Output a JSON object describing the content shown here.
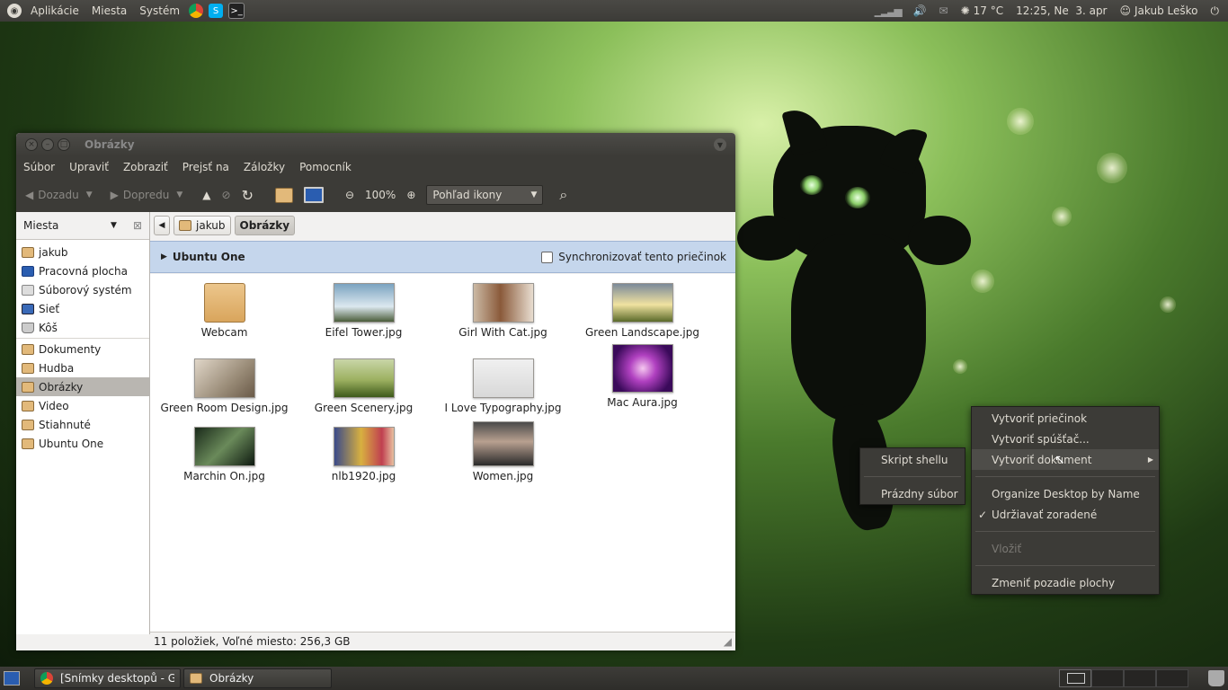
{
  "top_panel": {
    "menus": [
      "Aplikácie",
      "Miesta",
      "Systém"
    ],
    "weather": "17 °C",
    "clock": "12:25, Ne  3. apr",
    "user": "Jakub Leško"
  },
  "window": {
    "title": "Obrázky",
    "menu": [
      "Súbor",
      "Upraviť",
      "Zobraziť",
      "Prejsť na",
      "Záložky",
      "Pomocník"
    ],
    "toolbar": {
      "back": "Dozadu",
      "forward": "Dopredu",
      "zoom": "100%",
      "view_mode": "Pohľad ikony"
    },
    "sidebar": {
      "header": "Miesta",
      "group1": [
        "jakub",
        "Pracovná plocha",
        "Súborový systém",
        "Sieť",
        "Kôš"
      ],
      "group2": [
        "Dokumenty",
        "Hudba",
        "Obrázky",
        "Video",
        "Stiahnuté",
        "Ubuntu One"
      ],
      "selected": "Obrázky"
    },
    "breadcrumb": [
      "jakub",
      "Obrázky"
    ],
    "ubuntu_one": {
      "label": "Ubuntu One",
      "sync_label": "Synchronizovať tento priečinok"
    },
    "files": [
      {
        "name": "Webcam"
      },
      {
        "name": "Eifel Tower.jpg"
      },
      {
        "name": "Girl With Cat.jpg"
      },
      {
        "name": "Green Landscape.jpg"
      },
      {
        "name": "Green Room Design.jpg"
      },
      {
        "name": "Green Scenery.jpg"
      },
      {
        "name": "I Love Typography.jpg"
      },
      {
        "name": "Mac Aura.jpg"
      },
      {
        "name": "Marchin On.jpg"
      },
      {
        "name": "nlb1920.jpg"
      },
      {
        "name": "Women.jpg"
      }
    ],
    "status": "11 položiek, Voľné miesto: 256,3 GB"
  },
  "context_menu": {
    "items": [
      "Vytvoriť priečinok",
      "Vytvoriť spúšťač...",
      "Vytvoriť dokument",
      "Organize Desktop by Name",
      "Udržiavať zoradené",
      "Vložiť",
      "Zmeniť pozadie plochy"
    ],
    "check_mark": "✓"
  },
  "submenu": {
    "items": [
      "Skript shellu",
      "Prázdny súbor"
    ]
  },
  "taskbar": {
    "tasks": [
      "[Snímky desktopů - G...",
      "Obrázky"
    ]
  }
}
